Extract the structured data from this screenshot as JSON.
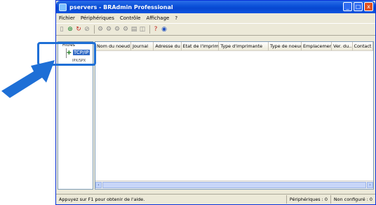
{
  "window": {
    "title": "pservers - BRAdmin Professional",
    "controls": [
      "_",
      "□",
      "x"
    ]
  },
  "menu": [
    "Fichier",
    "Périphériques",
    "Contrôle",
    "Affichage",
    "?"
  ],
  "tree": {
    "root": "Filtres",
    "selected": "TCP/IP",
    "sub": "IPX/SPX"
  },
  "table": {
    "columns": [
      "Nom du noeud",
      "Journal",
      "Adresse du ...",
      "Etat de l'imprimante",
      "Type d'imprimante",
      "Type de noeud",
      "Emplacement",
      "Ver. du...",
      "Contact"
    ]
  },
  "status": {
    "help": "Appuyez sur F1 pour obtenir de l'aide.",
    "peripherals": "Périphériques : 0",
    "unconfigured": "Non configuré : 0"
  },
  "colors": {
    "accent_arrow": "#1e6fd6",
    "titlebar": "#0a4fd8"
  }
}
